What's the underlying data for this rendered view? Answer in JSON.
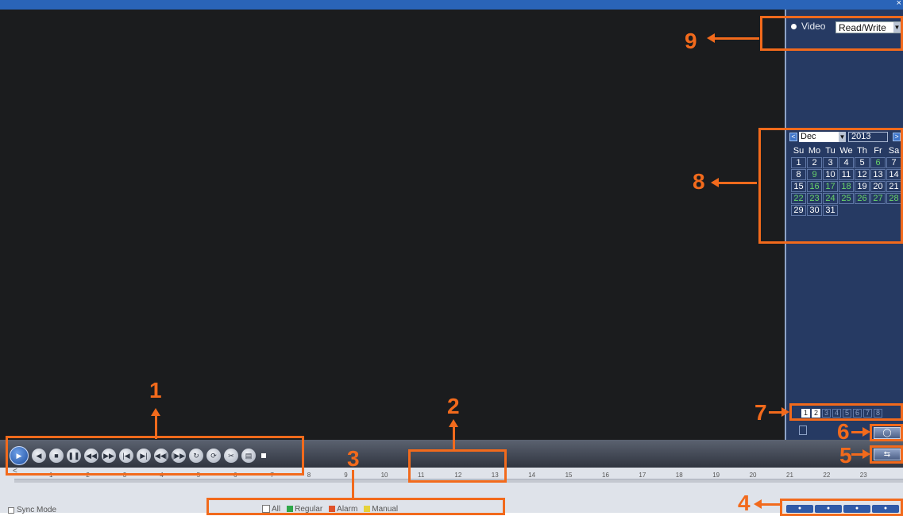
{
  "window": {
    "close_glyph": "×"
  },
  "video_source": {
    "label": "Video",
    "mode": "Read/Write"
  },
  "calendar": {
    "month": "Dec",
    "year": "2013",
    "prev_glyph": "<",
    "next_glyph": ">",
    "weekdays": [
      "Su",
      "Mo",
      "Tu",
      "We",
      "Th",
      "Fr",
      "Sa"
    ],
    "days": [
      "1",
      "2",
      "3",
      "4",
      "5",
      "6",
      "7",
      "8",
      "9",
      "10",
      "11",
      "12",
      "13",
      "14",
      "15",
      "16",
      "17",
      "18",
      "19",
      "20",
      "21",
      "22",
      "23",
      "24",
      "25",
      "26",
      "27",
      "28",
      "29",
      "30",
      "31"
    ]
  },
  "channels": [
    "1",
    "2",
    "3",
    "4",
    "5",
    "6",
    "7",
    "8"
  ],
  "timeline": {
    "start_glyph": "<",
    "hours": [
      "1",
      "2",
      "3",
      "4",
      "5",
      "6",
      "7",
      "8",
      "9",
      "10",
      "11",
      "12",
      "13",
      "14",
      "15",
      "16",
      "17",
      "18",
      "19",
      "20",
      "21",
      "22",
      "23"
    ]
  },
  "bottom": {
    "sync_mode": "Sync Mode",
    "legend": {
      "all": "All",
      "regular": "Regular",
      "alarm": "Alarm",
      "manual": "Manual"
    },
    "colors": {
      "regular": "#2fa84a",
      "alarm": "#e0522a",
      "manual": "#e6d23a",
      "all": "#ffffff"
    }
  },
  "callouts": [
    "1",
    "2",
    "3",
    "4",
    "5",
    "6",
    "7",
    "8",
    "9"
  ],
  "icons": {
    "controls": [
      "play-icon",
      "rewind-icon",
      "stop-icon",
      "pause-icon",
      "slow-icon",
      "fast-forward-icon",
      "previous-frame-icon",
      "next-frame-icon",
      "previous-file-icon",
      "next-file-icon",
      "repeat-icon",
      "refresh-icon",
      "clip-icon",
      "backup-icon"
    ]
  }
}
